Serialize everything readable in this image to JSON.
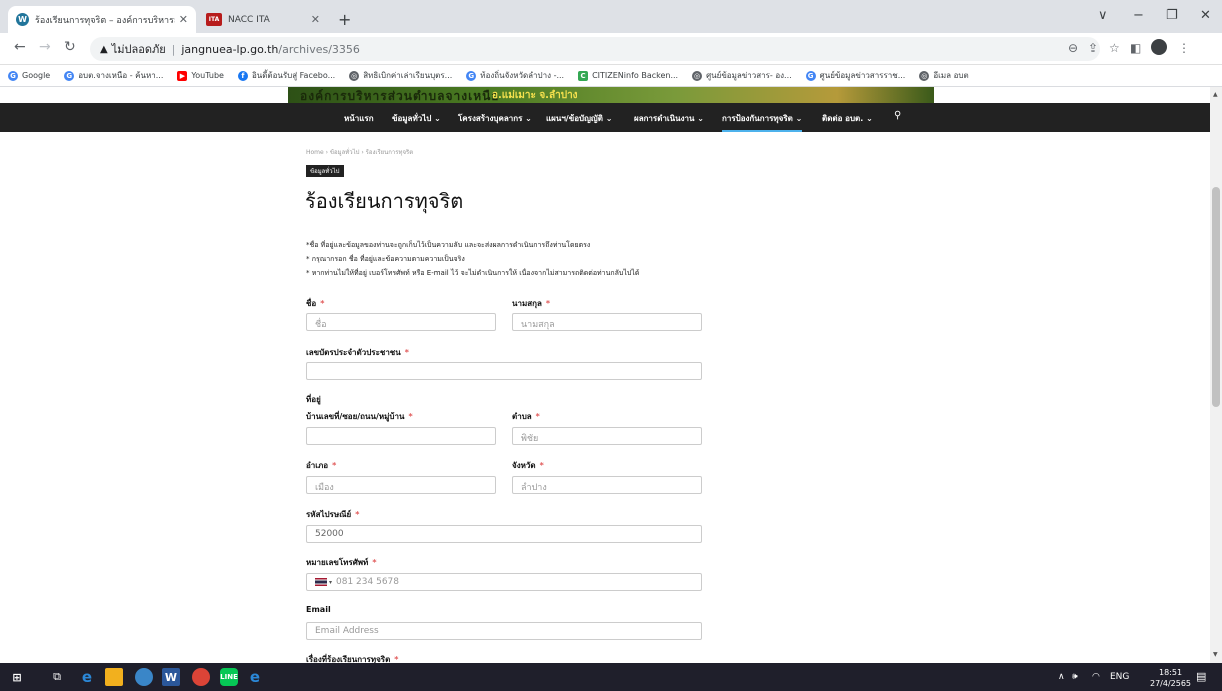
{
  "browser": {
    "tabs": [
      {
        "title": "ร้องเรียนการทุจริต – องค์การบริหารส่วน",
        "active": true
      },
      {
        "title": "NACC ITA",
        "active": false
      }
    ],
    "new_tab": "+",
    "window_controls": [
      "∨",
      "−",
      "❐",
      "✕"
    ],
    "address": {
      "security_label": "ไม่ปลอดภัย",
      "host": "jangnuea-lp.go.th",
      "path": "/archives/3356"
    },
    "bookmarks": [
      {
        "label": "Google",
        "icon": "google-icon",
        "color": "#4285f4"
      },
      {
        "label": "อบต.จางเหนือ - ค้นหา...",
        "icon": "google-icon",
        "color": "#4285f4"
      },
      {
        "label": "YouTube",
        "icon": "youtube-icon",
        "color": "#ff0000"
      },
      {
        "label": "อินดี้ต้อนรับสู่ Facebo...",
        "icon": "facebook-icon",
        "color": "#1877f2"
      },
      {
        "label": "สิทธิเบิกค่าเล่าเรียนบุตร...",
        "icon": "globe-icon",
        "color": "#5f6368"
      },
      {
        "label": "ท้องถิ่นจังหวัดลำปาง -...",
        "icon": "google-icon",
        "color": "#4285f4"
      },
      {
        "label": "CITIZENinfo Backen...",
        "icon": "citizen-icon",
        "color": "#34a853"
      },
      {
        "label": "ศูนย์ข้อมูลข่าวสาร- อง...",
        "icon": "globe-icon",
        "color": "#5f6368"
      },
      {
        "label": "ศูนย์ข้อมูลข่าวสารราช...",
        "icon": "google-icon",
        "color": "#4285f4"
      },
      {
        "label": "อีเมล อบต",
        "icon": "globe-icon",
        "color": "#5f6368"
      }
    ]
  },
  "site": {
    "banner_title": "องค์การบริหารส่วนตำบลจางเหนือ",
    "banner_subtitle": "อ.แม่เมาะ จ.ลำปาง",
    "menu": [
      {
        "label": "หน้าแรก",
        "active": false
      },
      {
        "label": "ข้อมูลทั่วไป ⌄",
        "active": false
      },
      {
        "label": "โครงสร้างบุคลากร ⌄",
        "active": false
      },
      {
        "label": "แผนฯ/ข้อบัญญัติ ⌄",
        "active": false
      },
      {
        "label": "ผลการดำเนินงาน ⌄",
        "active": false
      },
      {
        "label": "การป้องกันการทุจริต ⌄",
        "active": true
      },
      {
        "label": "ติดต่อ อบต. ⌄",
        "active": false
      }
    ],
    "breadcrumb": "Home  ›  ข้อมูลทั่วไป  ›  ร้องเรียนการทุจริต",
    "category_badge": "ข้อมูลทั่วไป",
    "page_title": "ร้องเรียนการทุจริต",
    "notes": [
      "*ชื่อ ที่อยู่และข้อมูลของท่านจะถูกเก็บไว้เป็นความลับ และจะส่งผลการดำเนินการถึงท่านโดยตรง",
      "* กรุณากรอก ชื่อ ที่อยู่และข้อความตามความเป็นจริง",
      "* หากท่านไม่ให้ที่อยู่ เบอร์โทรศัพท์ หรือ E-mail ไว้ จะไม่ดำเนินการให้ เนื่องจากไม่สามารถติดต่อท่านกลับไปได้"
    ],
    "form": {
      "first_name_label": "ชื่อ",
      "first_name_placeholder": "ชื่อ",
      "last_name_label": "นามสกุล",
      "last_name_placeholder": "นามสกุล",
      "id_card_label": "เลขบัตรประจำตัวประชาชน",
      "address_heading": "ที่อยู่",
      "house_label": "บ้านเลขที่/ซอย/ถนน/หมู่บ้าน",
      "subdistrict_label": "ตำบล",
      "subdistrict_value": "พิชัย",
      "district_label": "อำเภอ",
      "district_value": "เมือง",
      "province_label": "จังหวัด",
      "province_value": "ลำปาง",
      "postal_label": "รหัสไปรษณีย์",
      "postal_value": "52000",
      "phone_label": "หมายเลขโทรศัพท์",
      "phone_placeholder": "081 234 5678",
      "email_label": "Email",
      "email_placeholder": "Email Address",
      "subject_label": "เรื่องที่ร้องเรียนการทุจริต",
      "required_mark": "*"
    }
  },
  "taskbar": {
    "tray_lang": "ENG",
    "time": "18:51",
    "date": "27/4/2565"
  }
}
